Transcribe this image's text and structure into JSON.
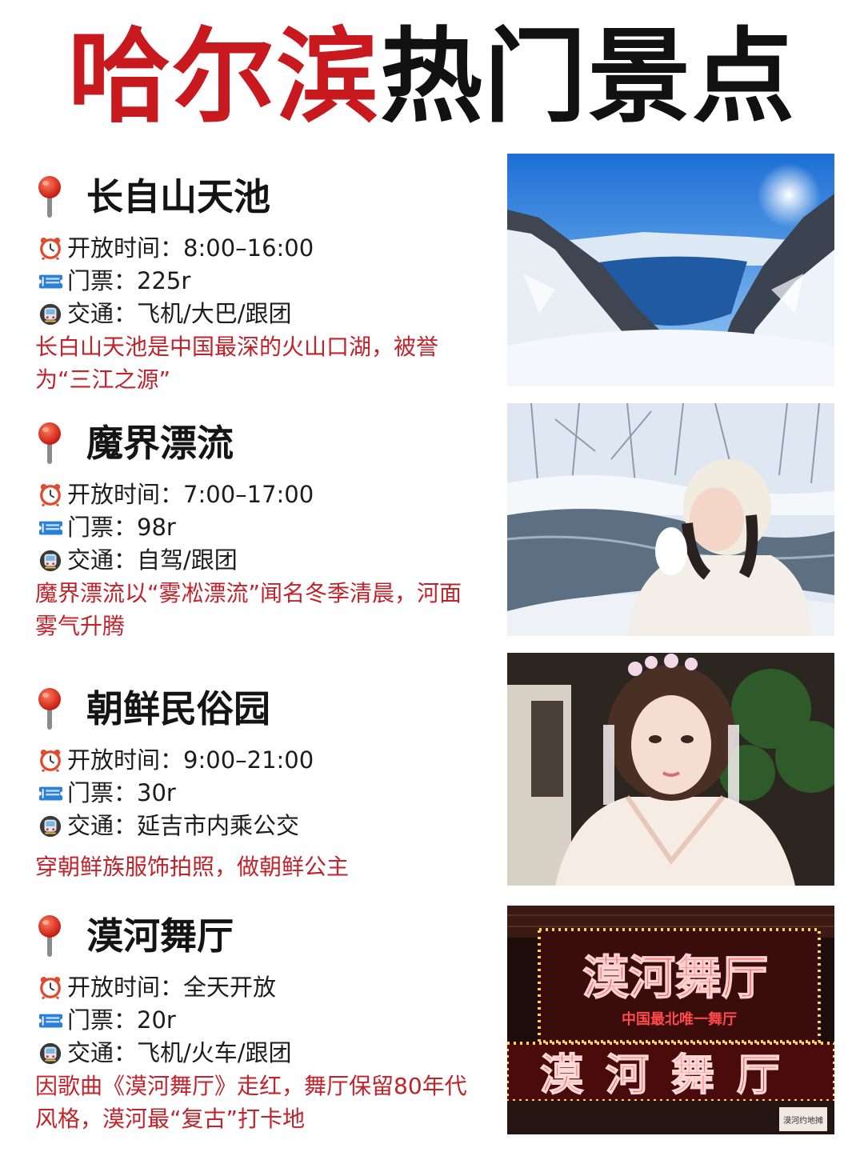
{
  "title": {
    "part1": "哈尔滨",
    "part2": "热门景点"
  },
  "spots": [
    {
      "name": "长自山天池",
      "hours_label": "开放时间：",
      "hours": "8:00–16:00",
      "ticket_label": "门票：",
      "ticket": "225r",
      "transport_label": "交通：",
      "transport": "飞机/大巴/跟团",
      "description": "长白山天池是中国最深的火山口湖，被誉为“三江之源”"
    },
    {
      "name": "魔界漂流",
      "hours_label": "开放时间：",
      "hours": "7:00–17:00",
      "ticket_label": "门票：",
      "ticket": "98r",
      "transport_label": "交通：",
      "transport": "自驾/跟团",
      "description": "魔界漂流以“雾凇漂流”闻名冬季清晨，河面雾气升腾"
    },
    {
      "name": "朝鲜民俗园",
      "hours_label": "开放时间：",
      "hours": "9:00–21:00",
      "ticket_label": "门票：",
      "ticket": "30r",
      "transport_label": "交通：",
      "transport": "延吉市内乘公交",
      "description": "穿朝鲜族服饰拍照，做朝鲜公主"
    },
    {
      "name": "漠河舞厅",
      "hours_label": "开放时间：",
      "hours": "全天开放",
      "ticket_label": "门票：",
      "ticket": "20r",
      "transport_label": "交通：",
      "transport": "飞机/火车/跟团",
      "description": "因歌曲《漠河舞厅》走红，舞厅保留80年代风格，漠河最“复古”打卡地"
    }
  ],
  "sign": {
    "top": "漠河舞厅",
    "sub": "中国最北唯一舞厅",
    "bottom": "漠河舞厅",
    "corner": "漠河约地摊"
  },
  "icons": {
    "pin": "map-pin-icon",
    "hours": "alarm-clock-icon",
    "ticket": "ticket-icon",
    "transport": "train-icon"
  },
  "colors": {
    "title_red": "#c8191f",
    "description_red": "#c2222a",
    "pin_red": "#d6301f"
  }
}
